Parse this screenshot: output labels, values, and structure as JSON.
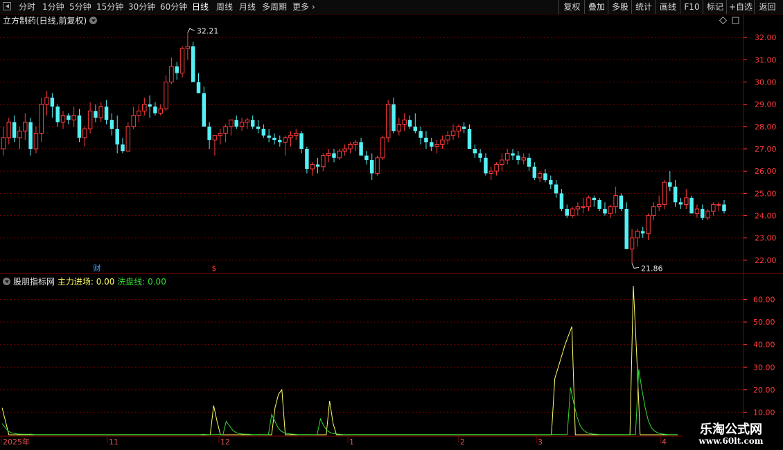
{
  "toolbar": {
    "periods": [
      "分时",
      "1分钟",
      "5分钟",
      "15分钟",
      "30分钟",
      "60分钟",
      "日线",
      "周线",
      "月线",
      "多周期",
      "更多"
    ],
    "active_period": "日线",
    "right_buttons": [
      "复权",
      "叠加",
      "多股",
      "统计",
      "画线",
      "F10",
      "标记",
      "+自选",
      "返回"
    ]
  },
  "main_panel": {
    "title": "立方制药(日线,前复权)",
    "high_label": "32.21",
    "low_label": "21.86",
    "markers": {
      "cai": "财",
      "dollar": "$"
    }
  },
  "indicator_panel": {
    "name": "股朋指标网",
    "line1_label": "主力进场: 0.00",
    "line2_label": "洗盘线: 0.00"
  },
  "colors": {
    "up": "#ff3b3b",
    "down": "#54f0f4",
    "grid": "#7a0000",
    "axis_text": "#ff3a3a",
    "line1": "#ffff66",
    "line2": "#33dd33"
  },
  "watermark": {
    "title": "乐淘公式网",
    "url": "www.60lt.com"
  },
  "chart_data": [
    {
      "type": "candlestick",
      "ylim": [
        21.5,
        32.5
      ],
      "yticks": [
        "32.00",
        "31.00",
        "30.00",
        "29.00",
        "28.00",
        "27.00",
        "26.00",
        "25.00",
        "24.00",
        "23.00",
        "22.00"
      ],
      "ohlc": [
        [
          27.0,
          28.0,
          26.7,
          27.5
        ],
        [
          27.5,
          28.4,
          27.2,
          28.2
        ],
        [
          28.2,
          28.5,
          27.3,
          27.5
        ],
        [
          27.5,
          28.0,
          27.0,
          27.8
        ],
        [
          27.8,
          28.6,
          27.4,
          28.2
        ],
        [
          28.2,
          28.4,
          26.7,
          27.0
        ],
        [
          27.0,
          28.0,
          26.8,
          27.7
        ],
        [
          27.7,
          29.3,
          27.3,
          29.0
        ],
        [
          29.0,
          29.6,
          28.5,
          29.3
        ],
        [
          29.3,
          29.5,
          28.4,
          28.9
        ],
        [
          28.9,
          29.0,
          28.0,
          28.2
        ],
        [
          28.2,
          28.7,
          27.9,
          28.5
        ],
        [
          28.5,
          28.6,
          28.1,
          28.3
        ],
        [
          28.3,
          28.9,
          28.0,
          28.5
        ],
        [
          28.5,
          28.8,
          27.3,
          27.5
        ],
        [
          27.5,
          28.0,
          27.1,
          27.9
        ],
        [
          27.9,
          29.1,
          27.7,
          28.7
        ],
        [
          28.7,
          29.0,
          28.2,
          28.4
        ],
        [
          28.4,
          29.1,
          28.2,
          28.9
        ],
        [
          28.9,
          29.2,
          28.1,
          28.3
        ],
        [
          28.3,
          28.6,
          27.6,
          27.9
        ],
        [
          27.9,
          28.5,
          26.8,
          27.2
        ],
        [
          27.2,
          27.5,
          26.8,
          26.9
        ],
        [
          26.9,
          28.2,
          26.9,
          28.0
        ],
        [
          28.0,
          28.9,
          27.9,
          28.5
        ],
        [
          28.5,
          29.0,
          28.2,
          28.7
        ],
        [
          28.7,
          29.3,
          28.5,
          29.0
        ],
        [
          29.0,
          29.4,
          28.4,
          28.9
        ],
        [
          28.9,
          29.1,
          28.5,
          28.6
        ],
        [
          28.6,
          29.0,
          28.5,
          28.8
        ],
        [
          28.8,
          30.3,
          28.7,
          30.0
        ],
        [
          30.0,
          31.1,
          29.9,
          30.7
        ],
        [
          30.7,
          30.9,
          30.1,
          30.4
        ],
        [
          30.4,
          31.6,
          30.2,
          31.5
        ],
        [
          31.5,
          32.21,
          31.0,
          31.6
        ],
        [
          31.6,
          31.8,
          30.3,
          30.0
        ],
        [
          30.0,
          30.4,
          29.6,
          29.5
        ],
        [
          29.5,
          29.8,
          28.3,
          28.0
        ],
        [
          28.0,
          28.2,
          27.0,
          27.4
        ],
        [
          27.4,
          27.6,
          26.7,
          27.6
        ],
        [
          27.6,
          27.9,
          27.2,
          27.7
        ],
        [
          27.7,
          28.1,
          27.3,
          28.0
        ],
        [
          28.0,
          28.3,
          27.6,
          28.3
        ],
        [
          28.3,
          28.5,
          27.9,
          28.0
        ],
        [
          28.0,
          28.4,
          27.8,
          28.2
        ],
        [
          28.2,
          28.4,
          27.9,
          28.3
        ],
        [
          28.3,
          28.5,
          27.9,
          28.0
        ],
        [
          28.0,
          28.3,
          27.7,
          27.9
        ],
        [
          27.9,
          28.1,
          27.5,
          27.6
        ],
        [
          27.6,
          27.9,
          27.3,
          27.5
        ],
        [
          27.5,
          27.7,
          27.2,
          27.4
        ],
        [
          27.4,
          27.6,
          27.1,
          27.3
        ],
        [
          27.3,
          27.6,
          26.7,
          27.5
        ],
        [
          27.5,
          27.8,
          27.1,
          27.6
        ],
        [
          27.6,
          27.9,
          27.4,
          27.7
        ],
        [
          27.7,
          27.8,
          26.8,
          27.0
        ],
        [
          27.0,
          27.1,
          25.9,
          26.1
        ],
        [
          26.1,
          26.4,
          25.8,
          26.3
        ],
        [
          26.3,
          26.6,
          25.9,
          26.2
        ],
        [
          26.2,
          26.8,
          26.0,
          26.7
        ],
        [
          26.7,
          27.0,
          26.4,
          26.8
        ],
        [
          26.8,
          27.0,
          26.4,
          26.6
        ],
        [
          26.6,
          27.0,
          26.5,
          26.9
        ],
        [
          26.9,
          27.2,
          26.7,
          27.0
        ],
        [
          27.0,
          27.3,
          26.8,
          27.2
        ],
        [
          27.2,
          27.4,
          26.9,
          27.3
        ],
        [
          27.3,
          27.5,
          26.8,
          26.7
        ],
        [
          26.7,
          26.9,
          26.3,
          26.5
        ],
        [
          26.5,
          26.8,
          25.6,
          25.9
        ],
        [
          25.9,
          26.7,
          25.8,
          26.6
        ],
        [
          26.6,
          27.6,
          26.5,
          27.5
        ],
        [
          27.5,
          29.2,
          27.3,
          29.0
        ],
        [
          29.0,
          29.3,
          27.7,
          27.8
        ],
        [
          27.8,
          28.4,
          27.6,
          28.1
        ],
        [
          28.1,
          28.6,
          27.8,
          28.3
        ],
        [
          28.3,
          28.5,
          27.9,
          28.0
        ],
        [
          28.0,
          28.6,
          27.7,
          27.8
        ],
        [
          27.8,
          28.0,
          27.2,
          27.5
        ],
        [
          27.5,
          27.8,
          27.0,
          27.3
        ],
        [
          27.3,
          27.5,
          26.9,
          27.1
        ],
        [
          27.1,
          27.4,
          26.8,
          27.2
        ],
        [
          27.2,
          27.6,
          27.0,
          27.4
        ],
        [
          27.4,
          27.8,
          27.2,
          27.6
        ],
        [
          27.6,
          28.1,
          27.4,
          27.8
        ],
        [
          27.8,
          28.1,
          27.5,
          28.0
        ],
        [
          28.0,
          28.2,
          27.7,
          27.9
        ],
        [
          27.9,
          28.1,
          27.0,
          27.0
        ],
        [
          27.0,
          27.2,
          26.6,
          26.8
        ],
        [
          26.8,
          27.0,
          26.4,
          26.6
        ],
        [
          26.6,
          26.8,
          25.8,
          25.9
        ],
        [
          25.9,
          26.2,
          25.6,
          26.0
        ],
        [
          26.0,
          26.4,
          25.8,
          26.3
        ],
        [
          26.3,
          26.8,
          26.0,
          26.5
        ],
        [
          26.5,
          27.0,
          26.3,
          26.8
        ],
        [
          26.8,
          27.0,
          26.5,
          26.7
        ],
        [
          26.7,
          26.9,
          26.3,
          26.5
        ],
        [
          26.5,
          26.8,
          26.3,
          26.6
        ],
        [
          26.6,
          26.8,
          26.0,
          26.2
        ],
        [
          26.2,
          26.4,
          25.6,
          25.7
        ],
        [
          25.7,
          26.0,
          25.5,
          25.9
        ],
        [
          25.9,
          26.1,
          25.5,
          25.6
        ],
        [
          25.6,
          25.8,
          25.2,
          25.4
        ],
        [
          25.4,
          25.6,
          24.8,
          25.0
        ],
        [
          25.0,
          25.2,
          24.2,
          24.3
        ],
        [
          24.3,
          24.5,
          23.9,
          24.0
        ],
        [
          24.0,
          24.4,
          23.9,
          24.3
        ],
        [
          24.3,
          24.6,
          24.0,
          24.4
        ],
        [
          24.4,
          24.8,
          24.1,
          24.4
        ],
        [
          24.4,
          24.9,
          24.2,
          24.8
        ],
        [
          24.8,
          24.9,
          24.4,
          24.7
        ],
        [
          24.7,
          24.8,
          24.2,
          24.3
        ],
        [
          24.3,
          24.6,
          24.0,
          24.1
        ],
        [
          24.1,
          24.5,
          23.9,
          24.4
        ],
        [
          24.4,
          25.3,
          24.1,
          24.9
        ],
        [
          24.9,
          25.0,
          24.2,
          24.3
        ],
        [
          24.3,
          24.6,
          23.4,
          22.5
        ],
        [
          22.5,
          23.4,
          21.86,
          23.0
        ],
        [
          23.0,
          23.4,
          22.6,
          23.3
        ],
        [
          23.3,
          23.5,
          23.0,
          23.2
        ],
        [
          23.2,
          24.1,
          22.9,
          24.0
        ],
        [
          24.0,
          24.6,
          23.8,
          24.4
        ],
        [
          24.4,
          24.9,
          24.2,
          24.5
        ],
        [
          24.5,
          25.6,
          24.3,
          25.5
        ],
        [
          25.5,
          26.0,
          25.1,
          25.3
        ],
        [
          25.3,
          25.6,
          24.4,
          24.6
        ],
        [
          24.6,
          24.8,
          24.3,
          24.5
        ],
        [
          24.5,
          25.2,
          24.3,
          24.8
        ],
        [
          24.8,
          24.9,
          24.1,
          24.1
        ],
        [
          24.1,
          24.5,
          23.9,
          24.3
        ],
        [
          24.3,
          24.5,
          23.8,
          23.9
        ],
        [
          23.9,
          24.3,
          23.8,
          24.2
        ],
        [
          24.2,
          24.6,
          24.0,
          24.5
        ],
        [
          24.5,
          24.6,
          24.2,
          24.5
        ],
        [
          24.5,
          24.7,
          24.1,
          24.2
        ]
      ]
    },
    {
      "type": "line",
      "ylim": [
        0,
        70
      ],
      "yticks": [
        "60.00",
        "50.00",
        "40.00",
        "30.00",
        "20.00",
        "10.00"
      ],
      "x_labels": [
        "2025年",
        "11",
        "12",
        "1",
        "2",
        "3",
        "4"
      ],
      "series": [
        {
          "name": "主力进场",
          "values": [
            12,
            6,
            0,
            0,
            0,
            0,
            0,
            0,
            0,
            0,
            0,
            0,
            0,
            0,
            0,
            0,
            0,
            0,
            0,
            0,
            0,
            0,
            0,
            0,
            0,
            0,
            0,
            0,
            0,
            0,
            0,
            0,
            0,
            0,
            0,
            0,
            0,
            0,
            0,
            0,
            0,
            0,
            0,
            0,
            0,
            0,
            0,
            0,
            0,
            0,
            0,
            0,
            0,
            0,
            0,
            0,
            0,
            0,
            0,
            0,
            0,
            0,
            13,
            6,
            0,
            0,
            0,
            0,
            0,
            0,
            0,
            0,
            0,
            0,
            0,
            0,
            0,
            0,
            0,
            0,
            12,
            18,
            20,
            0,
            0,
            0,
            0,
            0,
            0,
            0,
            0,
            0,
            0,
            0,
            0,
            0,
            15,
            5,
            0,
            0,
            0,
            0,
            0,
            0,
            0,
            0,
            0,
            0,
            0,
            0,
            0,
            0,
            0,
            0,
            0,
            0,
            0,
            0,
            0,
            0,
            0,
            0,
            0,
            0,
            0,
            0,
            0,
            0,
            0,
            0,
            0,
            0,
            0,
            0,
            0,
            0,
            0,
            0,
            0,
            0,
            0,
            0,
            0,
            0,
            0,
            0,
            0,
            0,
            0,
            0,
            0,
            0,
            0,
            0,
            0,
            0,
            0,
            0,
            0,
            0,
            0,
            0,
            25,
            30,
            35,
            40,
            44,
            48,
            0,
            0,
            0,
            0,
            0,
            0,
            0,
            0,
            0,
            0,
            0,
            0,
            0,
            0,
            0,
            0,
            0,
            66,
            35,
            0,
            0,
            0,
            0,
            0,
            0,
            0,
            0,
            0,
            0,
            0,
            0
          ]
        },
        {
          "name": "洗盘线",
          "values": [
            5,
            3,
            1.5,
            0.8,
            0.5,
            0.3,
            0.2,
            0.2,
            0.2,
            0.2,
            0.1,
            0.1,
            0.1,
            0.1,
            0.1,
            0.1,
            0.1,
            0.1,
            0.1,
            0.1,
            0.1,
            0.1,
            0.1,
            0.1,
            0.1,
            0.1,
            0.1,
            0.1,
            0.1,
            0.1,
            0.1,
            0.1,
            0.1,
            0.1,
            0.1,
            0.1,
            0.1,
            0.1,
            0.1,
            0.1,
            0.1,
            0.1,
            0.1,
            0.1,
            0.1,
            0.1,
            0.1,
            0.1,
            0.1,
            0.1,
            0.1,
            0.1,
            0.1,
            0.1,
            0.1,
            0.1,
            0.1,
            0.1,
            0.1,
            0.1,
            0.1,
            0.1,
            0.2,
            0.1,
            0.1,
            0.1,
            0.1,
            0.1,
            0.1,
            6,
            4,
            2,
            1,
            0.5,
            0.3,
            0.2,
            0.2,
            0.1,
            0.1,
            0.1,
            0.1,
            0.1,
            0.1,
            9,
            6,
            3,
            1.5,
            0.8,
            0.5,
            0.3,
            0.2,
            0.1,
            0.1,
            0.1,
            0.1,
            0.1,
            0.1,
            0.1,
            7,
            4,
            2,
            1,
            0.5,
            0.3,
            0.2,
            0.1,
            0.1,
            0.1,
            0.1,
            0.1,
            0.1,
            0.1,
            0.1,
            0.1,
            0.1,
            0.1,
            0.1,
            0.1,
            0.1,
            0.1,
            0.1,
            0.1,
            0.1,
            0.1,
            0.1,
            0.1,
            0.1,
            0.1,
            0.1,
            0.1,
            0.1,
            0.1,
            0.1,
            0.1,
            0.1,
            0.1,
            0.1,
            0.1,
            0.1,
            0.1,
            0.1,
            0.1,
            0.1,
            0.1,
            0.1,
            0.1,
            0.1,
            0.1,
            0.1,
            0.1,
            0.1,
            0.1,
            0.1,
            0.1,
            0.1,
            0.1,
            0.1,
            0.1,
            0.1,
            0.1,
            0.1,
            0.1,
            0.1,
            0.1,
            0.1,
            0.1,
            0.1,
            0.1,
            0.1,
            0.1,
            0.1,
            0.1,
            0.1,
            0.1,
            0.1,
            21,
            14,
            8,
            4,
            2,
            1,
            0.5,
            0.3,
            0.2,
            0.1,
            0.1,
            0.1,
            0.1,
            0.1,
            0.1,
            0.1,
            0.1,
            0.1,
            0.1,
            0.1,
            0.1,
            29,
            20,
            12,
            6,
            3,
            1.5,
            0.8,
            0.4,
            0.2,
            0.1,
            0.1,
            0.1,
            0.1
          ]
        }
      ]
    }
  ]
}
